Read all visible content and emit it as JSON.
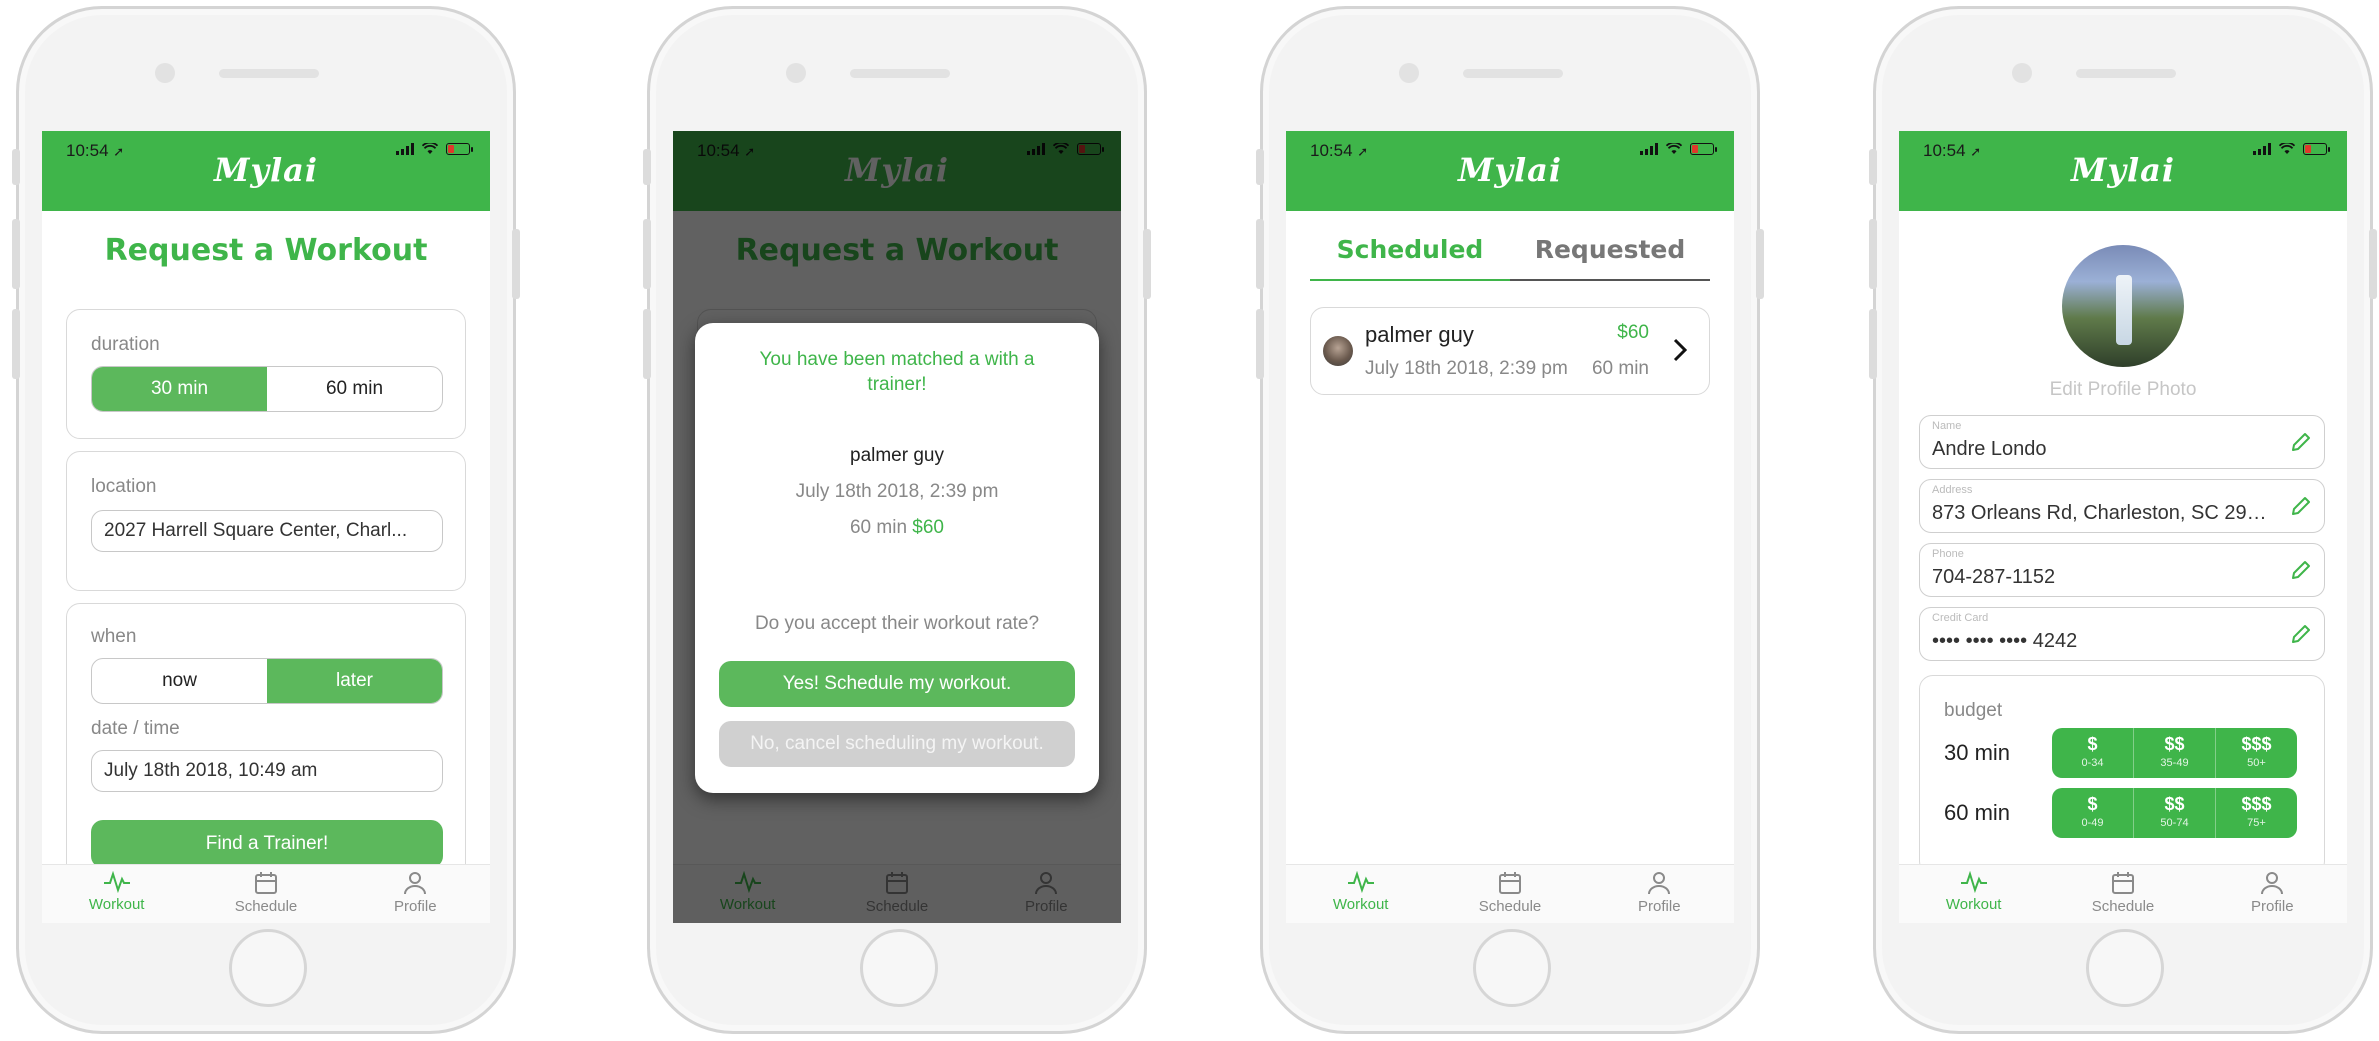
{
  "status": {
    "time": "10:54",
    "loc_glyph": "➚"
  },
  "brand": {
    "logo": "Mylai",
    "color": "#3fb54a"
  },
  "tabs": [
    {
      "label": "Workout",
      "icon": "activity-icon"
    },
    {
      "label": "Schedule",
      "icon": "calendar-icon"
    },
    {
      "label": "Profile",
      "icon": "person-icon"
    }
  ],
  "request": {
    "title": "Request a Workout",
    "duration_label": "duration",
    "duration_options": [
      "30 min",
      "60 min"
    ],
    "duration_selected": "30 min",
    "location_label": "location",
    "location_value": "2027 Harrell Square Center, Charl...",
    "when_label": "when",
    "when_options": [
      "now",
      "later"
    ],
    "when_selected": "later",
    "datetime_label": "date / time",
    "datetime_value": "July 18th 2018, 10:49 am",
    "find_button": "Find a Trainer!"
  },
  "match": {
    "message": "You have been matched a with a trainer!",
    "trainer_name": "palmer guy",
    "date": "July 18th 2018, 2:39 pm",
    "duration": "60 min",
    "price": "$60",
    "question": "Do you accept their workout rate?",
    "accept_button": "Yes! Schedule my workout.",
    "decline_button": "No, cancel scheduling my workout."
  },
  "schedule": {
    "tabs": [
      "Scheduled",
      "Requested"
    ],
    "active_tab": "Scheduled",
    "items": [
      {
        "name": "palmer guy",
        "price": "$60",
        "date": "July 18th 2018, 2:39 pm",
        "duration": "60 min"
      }
    ]
  },
  "profile": {
    "edit_photo": "Edit Profile Photo",
    "fields": [
      {
        "label": "Name",
        "value": "Andre Londo"
      },
      {
        "label": "Address",
        "value": "873 Orleans Rd, Charleston, SC 294..."
      },
      {
        "label": "Phone",
        "value": "704-287-1152"
      },
      {
        "label": "Credit Card",
        "value": "•••• •••• •••• 4242"
      }
    ],
    "budget": {
      "label": "budget",
      "rows": [
        {
          "label": "30 min",
          "tiers": [
            {
              "sym": "$",
              "range": "0-34"
            },
            {
              "sym": "$$",
              "range": "35-49"
            },
            {
              "sym": "$$$",
              "range": "50+"
            }
          ]
        },
        {
          "label": "60 min",
          "tiers": [
            {
              "sym": "$",
              "range": "0-49"
            },
            {
              "sym": "$$",
              "range": "50-74"
            },
            {
              "sym": "$$$",
              "range": "75+"
            }
          ]
        }
      ]
    }
  }
}
